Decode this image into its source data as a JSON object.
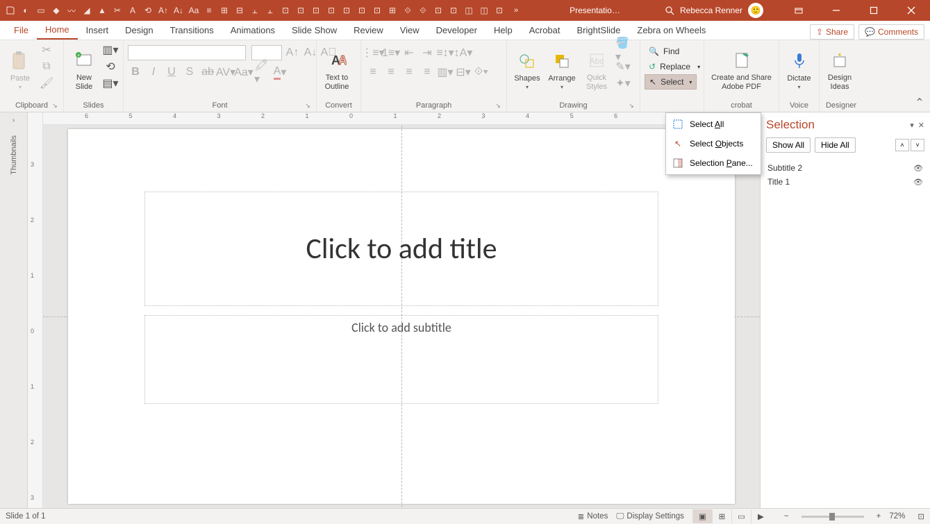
{
  "title": "Presentatio…",
  "user_name": "Rebecca Renner",
  "tabs": [
    "File",
    "Home",
    "Insert",
    "Design",
    "Transitions",
    "Animations",
    "Slide Show",
    "Review",
    "View",
    "Developer",
    "Help",
    "Acrobat",
    "BrightSlide",
    "Zebra on Wheels"
  ],
  "active_tab": "Home",
  "share_label": "Share",
  "comments_label": "Comments",
  "groups": {
    "clipboard": "Clipboard",
    "slides": "Slides",
    "font": "Font",
    "convert": "Convert",
    "paragraph": "Paragraph",
    "drawing": "Drawing",
    "adobe": "crobat",
    "voice": "Voice",
    "designer": "Designer"
  },
  "ribbon": {
    "paste": "Paste",
    "new_slide": "New\nSlide",
    "text_to_outline": "Text to\nOutline",
    "shapes": "Shapes",
    "arrange": "Arrange",
    "quick_styles": "Quick\nStyles",
    "find": "Find",
    "replace": "Replace",
    "select": "Select",
    "create_share_pdf": "Create and Share\nAdobe PDF",
    "dictate": "Dictate",
    "design_ideas": "Design\nIdeas"
  },
  "select_menu": {
    "select_all": "Select All",
    "select_objects": "Select Objects",
    "selection_pane": "Selection Pane..."
  },
  "selection_pane": {
    "title": "Selection",
    "show_all": "Show All",
    "hide_all": "Hide All",
    "items": [
      "Subtitle 2",
      "Title 1"
    ]
  },
  "slide": {
    "title_placeholder": "Click to add title",
    "subtitle_placeholder": "Click to add subtitle"
  },
  "status": {
    "slide_count": "Slide 1 of 1",
    "notes": "Notes",
    "display_settings": "Display Settings",
    "zoom": "72%"
  },
  "qat_more": "»"
}
